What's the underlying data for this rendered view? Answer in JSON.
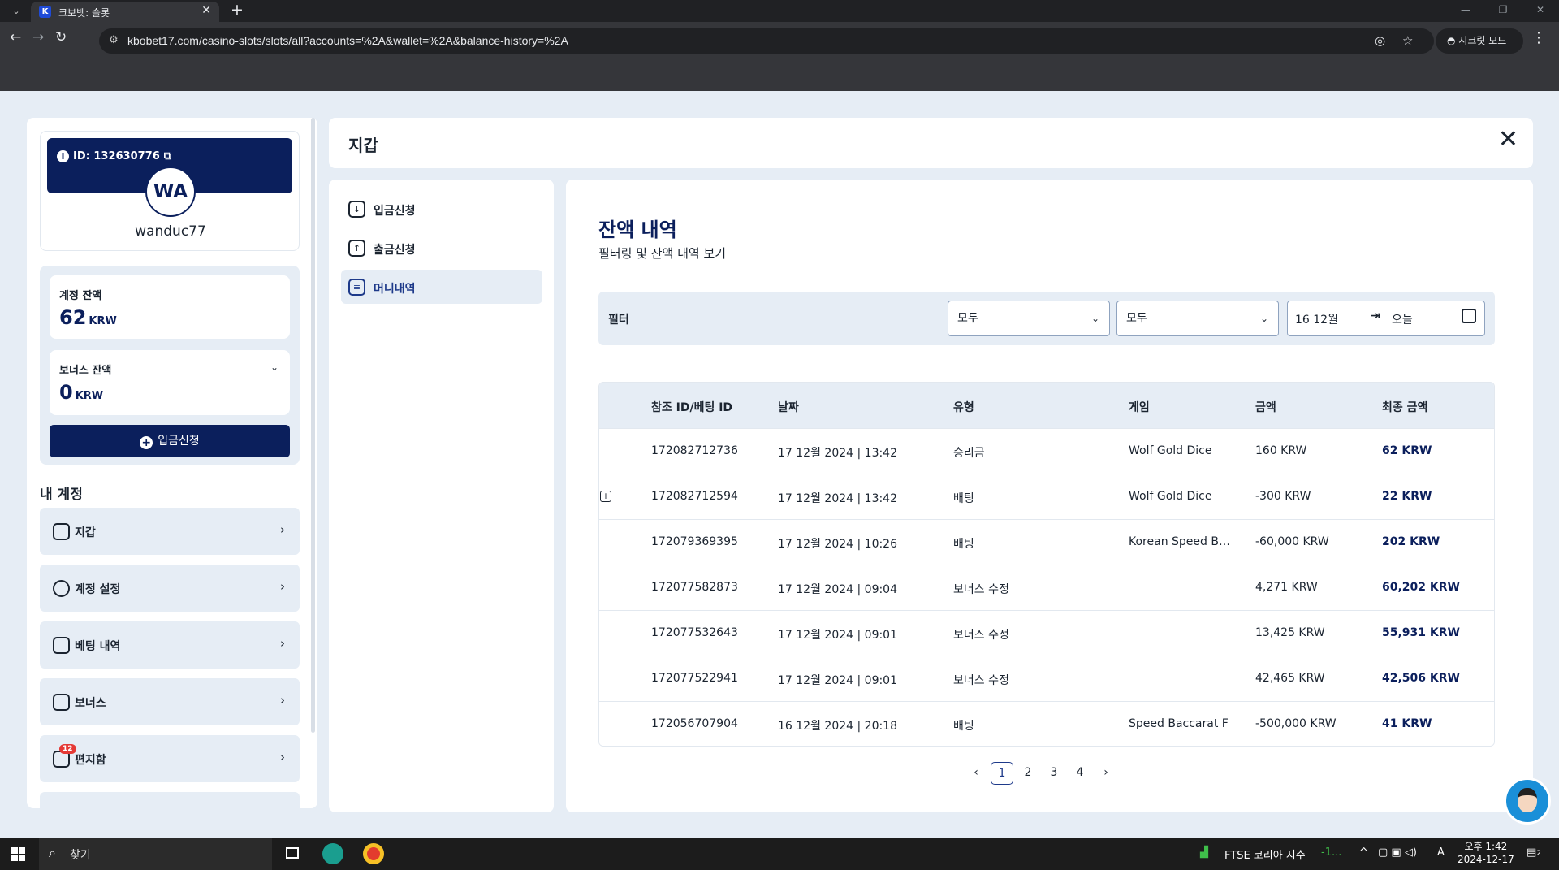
{
  "browser": {
    "tab_title": "크보벳: 슬롯",
    "favicon_letter": "K",
    "url": "kbobet17.com/casino-slots/slots/all?accounts=%2A&wallet=%2A&balance-history=%2A",
    "incognito_label": "시크릿 모드"
  },
  "profile": {
    "id_label": "ID: 132630776",
    "initials": "WA",
    "username": "wanduc77"
  },
  "balances": {
    "account_label": "계정 잔액",
    "account_value": "62",
    "account_currency": "KRW",
    "bonus_label": "보너스 잔액",
    "bonus_value": "0",
    "bonus_currency": "KRW",
    "deposit_button": "입금신청"
  },
  "account_menu": {
    "heading": "내 계정",
    "items": [
      {
        "label": "지갑",
        "icon": "wallet-icon"
      },
      {
        "label": "계정 설정",
        "icon": "user-settings-icon"
      },
      {
        "label": "베팅 내역",
        "icon": "bet-history-icon"
      },
      {
        "label": "보너스",
        "icon": "gift-icon"
      },
      {
        "label": "편지함",
        "icon": "inbox-icon",
        "badge": "12"
      }
    ]
  },
  "wallet": {
    "title": "지갑",
    "nav": [
      {
        "label": "입금신청",
        "icon": "download-icon"
      },
      {
        "label": "출금신청",
        "icon": "upload-icon"
      },
      {
        "label": "머니내역",
        "icon": "money-history-icon",
        "active": true
      }
    ],
    "balance_history": {
      "title": "잔액 내역",
      "subtitle": "필터링 및 잔액 내역 보기",
      "filter": {
        "label": "필터",
        "select_1": "모두",
        "select_2": "모두",
        "date_start": "16 12월",
        "date_end": "오늘"
      },
      "columns": [
        "참조 ID/베팅 ID",
        "날짜",
        "유형",
        "게임",
        "금액",
        "최종 금액"
      ],
      "rows": [
        {
          "ref": "172082712736",
          "date": "17 12월 2024 | 13:42",
          "type": "승리금",
          "game": "Wolf Gold Dice",
          "amount": "160 KRW",
          "final": "62 KRW"
        },
        {
          "ref": "172082712594",
          "date": "17 12월 2024 | 13:42",
          "type": "배팅",
          "game": "Wolf Gold Dice",
          "amount": "-300 KRW",
          "final": "22 KRW"
        },
        {
          "ref": "172079369395",
          "date": "17 12월 2024 | 10:26",
          "type": "배팅",
          "game": "Korean Speed B…",
          "amount": "-60,000 KRW",
          "final": "202 KRW"
        },
        {
          "ref": "172077582873",
          "date": "17 12월 2024 | 09:04",
          "type": "보너스 수정",
          "game": "",
          "amount": "4,271 KRW",
          "final": "60,202 KRW"
        },
        {
          "ref": "172077532643",
          "date": "17 12월 2024 | 09:01",
          "type": "보너스 수정",
          "game": "",
          "amount": "13,425 KRW",
          "final": "55,931 KRW"
        },
        {
          "ref": "172077522941",
          "date": "17 12월 2024 | 09:01",
          "type": "보너스 수정",
          "game": "",
          "amount": "42,465 KRW",
          "final": "42,506 KRW"
        },
        {
          "ref": "172056707904",
          "date": "16 12월 2024 | 20:18",
          "type": "배팅",
          "game": "Speed Baccarat F",
          "amount": "-500,000 KRW",
          "final": "41 KRW"
        }
      ],
      "pagination": {
        "pages": [
          "1",
          "2",
          "3",
          "4"
        ],
        "current": "1"
      }
    }
  },
  "taskbar": {
    "search_placeholder": "찾기",
    "ticker": "FTSE 코리아 지수",
    "ticker_change": "-1...",
    "time": "오후 1:42",
    "date": "2024-12-17",
    "ime": "A",
    "notifications": "2"
  },
  "colors": {
    "primary": "#0b1f5c",
    "accent": "#1e3a8a",
    "page_bg": "#e6edf5"
  }
}
